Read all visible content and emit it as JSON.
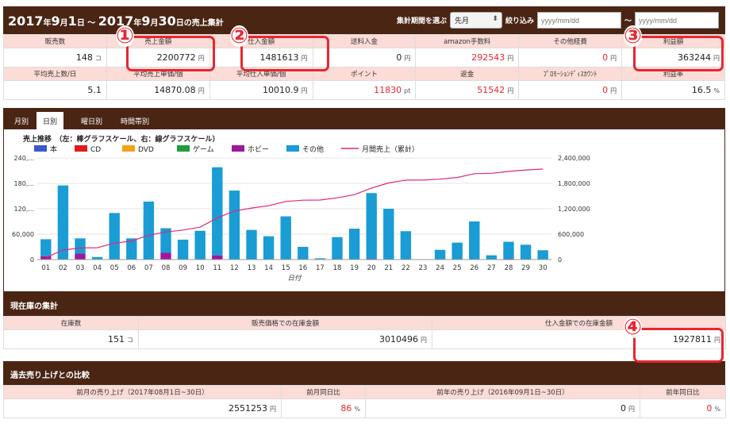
{
  "header": {
    "title_year": "2017",
    "title_year_unit": "年",
    "title_m1": "9",
    "title_m1_unit": "月",
    "title_d1": "1",
    "title_d1_unit": "日",
    "title_sep": " ～ ",
    "title_year2": "2017",
    "title_year2_unit": "年",
    "title_m2": "9",
    "title_m2_unit": "月",
    "title_d2": "30",
    "title_d2_unit": "日",
    "title_suffix": "の売上集計",
    "period_label": "集計期間を選ぶ",
    "period_value": "先月",
    "filter_label": "絞り込み",
    "date_placeholder": "yyyy/mm/dd",
    "tilde": "～"
  },
  "stats_row1": {
    "headers": [
      "販売数",
      "売上金額",
      "仕入金額",
      "送料入金",
      "amazon手数料",
      "その他経費",
      "利益額"
    ],
    "values": [
      {
        "v": "148",
        "u": "コ",
        "red": false
      },
      {
        "v": "2200772",
        "u": "円",
        "red": false
      },
      {
        "v": "1481613",
        "u": "円",
        "red": false
      },
      {
        "v": "0",
        "u": "円",
        "red": false
      },
      {
        "v": "292543",
        "u": "円",
        "red": true
      },
      {
        "v": "0",
        "u": "円",
        "red": true
      },
      {
        "v": "363244",
        "u": "円",
        "red": false
      }
    ]
  },
  "stats_row2": {
    "headers": [
      "平均売上数/日",
      "平均売上単価/個",
      "平均仕入単価/個",
      "ポイント",
      "返金",
      "ﾌﾟﾛﾓｰｼｮﾝﾃﾞｨｽｶｳﾝﾄ",
      "利益率"
    ],
    "values": [
      {
        "v": "5.1",
        "u": "",
        "red": false
      },
      {
        "v": "14870.08",
        "u": "円",
        "red": false
      },
      {
        "v": "10010.9",
        "u": "円",
        "red": false
      },
      {
        "v": "11830",
        "u": "pt",
        "red": true
      },
      {
        "v": "51542",
        "u": "円",
        "red": true
      },
      {
        "v": "0",
        "u": "円",
        "red": true
      },
      {
        "v": "16.5",
        "u": "%",
        "red": false
      }
    ]
  },
  "tabs": [
    "月別",
    "日別",
    "曜日別",
    "時間帯別"
  ],
  "active_tab": 1,
  "chart_data": {
    "type": "bar",
    "title": "売上推移　（左：棒グラフスケール、右：線グラフスケール）",
    "xlabel": "日付",
    "categories": [
      "01",
      "02",
      "03",
      "04",
      "05",
      "06",
      "07",
      "08",
      "09",
      "10",
      "11",
      "12",
      "13",
      "14",
      "15",
      "16",
      "17",
      "18",
      "19",
      "20",
      "21",
      "22",
      "23",
      "24",
      "25",
      "26",
      "27",
      "28",
      "29",
      "30"
    ],
    "ylim_left": [
      0,
      240000
    ],
    "yticks_left": [
      "0",
      "60,000",
      "120,...",
      "180,...",
      "240,..."
    ],
    "ylim_right": [
      0,
      2400000
    ],
    "yticks_right": [
      "0",
      "600,000",
      "1,200,000",
      "1,800,000",
      "2,400,000"
    ],
    "series": [
      {
        "name": "本",
        "color": "#3a5bc7",
        "type": "bar",
        "values": [
          0,
          0,
          0,
          0,
          0,
          0,
          0,
          0,
          0,
          0,
          0,
          0,
          0,
          0,
          0,
          0,
          0,
          0,
          0,
          0,
          0,
          0,
          0,
          0,
          0,
          0,
          0,
          0,
          0,
          0
        ]
      },
      {
        "name": "CD",
        "color": "#e01b1b",
        "type": "bar",
        "values": [
          0,
          0,
          0,
          0,
          0,
          0,
          0,
          0,
          0,
          0,
          0,
          0,
          0,
          0,
          0,
          0,
          0,
          0,
          0,
          0,
          0,
          0,
          0,
          0,
          0,
          0,
          0,
          0,
          0,
          0
        ]
      },
      {
        "name": "DVD",
        "color": "#f5a01a",
        "type": "bar",
        "values": [
          0,
          0,
          0,
          0,
          0,
          0,
          0,
          0,
          0,
          0,
          0,
          0,
          0,
          0,
          0,
          0,
          0,
          0,
          0,
          0,
          0,
          0,
          0,
          0,
          0,
          0,
          0,
          0,
          0,
          0
        ]
      },
      {
        "name": "ゲーム",
        "color": "#1e9e3a",
        "type": "bar",
        "values": [
          0,
          0,
          0,
          0,
          0,
          0,
          0,
          0,
          0,
          0,
          0,
          0,
          0,
          0,
          0,
          0,
          0,
          0,
          0,
          0,
          0,
          0,
          0,
          0,
          0,
          0,
          0,
          0,
          0,
          0
        ]
      },
      {
        "name": "ホビー",
        "color": "#a0189c",
        "type": "bar",
        "values": [
          8000,
          0,
          14000,
          0,
          0,
          0,
          0,
          16000,
          0,
          0,
          10000,
          0,
          0,
          0,
          0,
          0,
          0,
          0,
          0,
          2000,
          0,
          0,
          0,
          0,
          0,
          0,
          0,
          2000,
          0,
          0
        ]
      },
      {
        "name": "その他",
        "color": "#1a9cd4",
        "type": "bar",
        "values": [
          40000,
          175000,
          36000,
          6000,
          110000,
          50000,
          137000,
          58000,
          47000,
          68000,
          208000,
          163000,
          70000,
          55000,
          102000,
          30000,
          3000,
          53000,
          73000,
          155000,
          120000,
          67000,
          0,
          23000,
          40000,
          90000,
          10000,
          40000,
          35000,
          22000
        ]
      },
      {
        "name": "月間売上（累計）",
        "color": "#e0287a",
        "type": "line",
        "values": [
          48000,
          223000,
          273000,
          279000,
          389000,
          439000,
          576000,
          650000,
          697000,
          765000,
          983000,
          1146000,
          1216000,
          1271000,
          1373000,
          1403000,
          1406000,
          1459000,
          1532000,
          1689000,
          1809000,
          1876000,
          1876000,
          1899000,
          1939000,
          2029000,
          2039000,
          2081000,
          2116000,
          2138000
        ]
      }
    ]
  },
  "stock": {
    "title": "現在庫の集計",
    "headers": [
      "在庫数",
      "販売価格での在庫金額",
      "仕入金額での在庫金額"
    ],
    "values": [
      {
        "v": "151",
        "u": "コ"
      },
      {
        "v": "3010496",
        "u": "円"
      },
      {
        "v": "1927811",
        "u": "円"
      }
    ]
  },
  "past": {
    "title": "過去売り上げとの比較",
    "headers": [
      "前月の売り上げ（2017年08月1日~30日）",
      "前月同日比",
      "前年の売り上げ（2016年09月1日~30日）",
      "前年同日比"
    ],
    "values": [
      {
        "v": "2551253",
        "u": "円",
        "red": false
      },
      {
        "v": "86",
        "u": "%",
        "red": true
      },
      {
        "v": "0",
        "u": "円",
        "red": false
      },
      {
        "v": "0",
        "u": "%",
        "red": true
      }
    ]
  },
  "annotations": [
    "①",
    "②",
    "③",
    "④"
  ]
}
